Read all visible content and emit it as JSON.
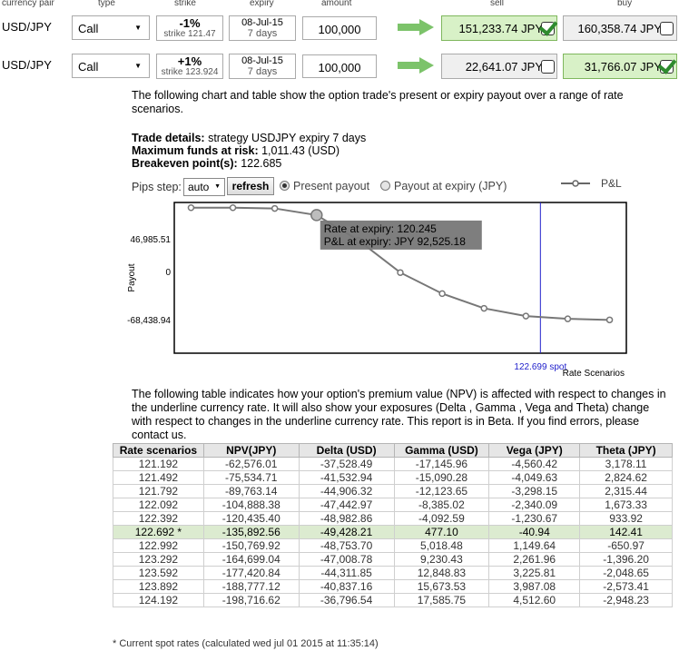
{
  "header": {
    "currency_pair": "currency pair",
    "type": "type",
    "strike": "strike",
    "expiry": "expiry",
    "amount": "amount",
    "sell": "sell",
    "buy": "buy"
  },
  "options": [
    {
      "pair": "USD/JPY",
      "type": "Call",
      "pct": "-1%",
      "strike": "strike 121.47",
      "expiry_date": "08-Jul-15",
      "expiry_days": "7 days",
      "amount": "100,000",
      "sell": "151,233.74 JPY",
      "buy": "160,358.74 JPY",
      "selected": "sell"
    },
    {
      "pair": "USD/JPY",
      "type": "Call",
      "pct": "+1%",
      "strike": "strike 123.924",
      "expiry_date": "08-Jul-15",
      "expiry_days": "7 days",
      "amount": "100,000",
      "sell": "22,641.07 JPY",
      "buy": "31,766.07 JPY",
      "selected": "buy"
    }
  ],
  "intro": "The following chart and table show the option trade's present or expiry payout over a range of rate scenarios.",
  "trade": {
    "details_label": "Trade details:",
    "details_value": "strategy USDJPY expiry 7 days",
    "max_label": "Maximum funds at risk:",
    "max_value": "1,011.43 (USD)",
    "be_label": "Breakeven point(s):",
    "be_value": "122.685"
  },
  "controls": {
    "pips_label": "Pips step:",
    "pips_value": "auto",
    "refresh": "refresh",
    "present": "Present payout",
    "expiry": "Payout at expiry (JPY)",
    "legend": "P&L"
  },
  "chart_data": {
    "type": "line",
    "ylabel": "Payout",
    "xlabel": "Rate Scenarios",
    "y_ticks": [
      "46,985.51",
      "0",
      "-68,438.94"
    ],
    "y_tick_values": [
      46985.51,
      0,
      -68438.94
    ],
    "ylim": [
      -115000,
      100000
    ],
    "x": [
      120.195,
      120.495,
      120.795,
      121.095,
      121.395,
      121.695,
      121.995,
      122.295,
      122.595,
      122.895,
      123.195
    ],
    "series": [
      {
        "name": "P&L",
        "values": [
          92525,
          92525,
          91500,
          82000,
          46000,
          0,
          -30000,
          -51000,
          -62000,
          -66000,
          -67500
        ]
      }
    ],
    "spot": 122.699,
    "spot_label": "122.699 spot",
    "tooltip_line1": "Rate at expiry: 120.245",
    "tooltip_line2": "P&L at expiry: JPY 92,525.18",
    "tooltip_index": 3
  },
  "para": "The following table indicates how your option's premium value (NPV) is affected with respect to changes in the underline currency rate. It will also show your exposures (Delta , Gamma , Vega and Theta) change with respect to changes in the underline currency rate. This report is in Beta. If you find errors, please contact us.",
  "table": {
    "headers": [
      "Rate scenarios",
      "NPV(JPY)",
      "Delta (USD)",
      "Gamma (USD)",
      "Vega (JPY)",
      "Theta (JPY)"
    ],
    "rows": [
      [
        "121.192",
        "-62,576.01",
        "-37,528.49",
        "-17,145.96",
        "-4,560.42",
        "3,178.11"
      ],
      [
        "121.492",
        "-75,534.71",
        "-41,532.94",
        "-15,090.28",
        "-4,049.63",
        "2,824.62"
      ],
      [
        "121.792",
        "-89,763.14",
        "-44,906.32",
        "-12,123.65",
        "-3,298.15",
        "2,315.44"
      ],
      [
        "122.092",
        "-104,888.38",
        "-47,442.97",
        "-8,385.02",
        "-2,340.09",
        "1,673.33"
      ],
      [
        "122.392",
        "-120,435.40",
        "-48,982.86",
        "-4,092.59",
        "-1,230.67",
        "933.92"
      ],
      [
        "122.692 *",
        "-135,892.56",
        "-49,428.21",
        "477.10",
        "-40.94",
        "142.41"
      ],
      [
        "122.992",
        "-150,769.92",
        "-48,753.70",
        "5,018.48",
        "1,149.64",
        "-650.97"
      ],
      [
        "123.292",
        "-164,699.04",
        "-47,008.78",
        "9,230.43",
        "2,261.96",
        "-1,396.20"
      ],
      [
        "123.592",
        "-177,420.84",
        "-44,311.85",
        "12,848.83",
        "3,225.81",
        "-2,048.65"
      ],
      [
        "123.892",
        "-188,777.12",
        "-40,837.16",
        "15,673.53",
        "3,987.08",
        "-2,573.41"
      ],
      [
        "124.192",
        "-198,716.62",
        "-36,796.54",
        "17,585.75",
        "4,512.60",
        "-2,948.23"
      ]
    ],
    "spot_row": 5
  },
  "footnote": "* Current spot rates (calculated wed jul 01 2015 at 11:35:14)"
}
